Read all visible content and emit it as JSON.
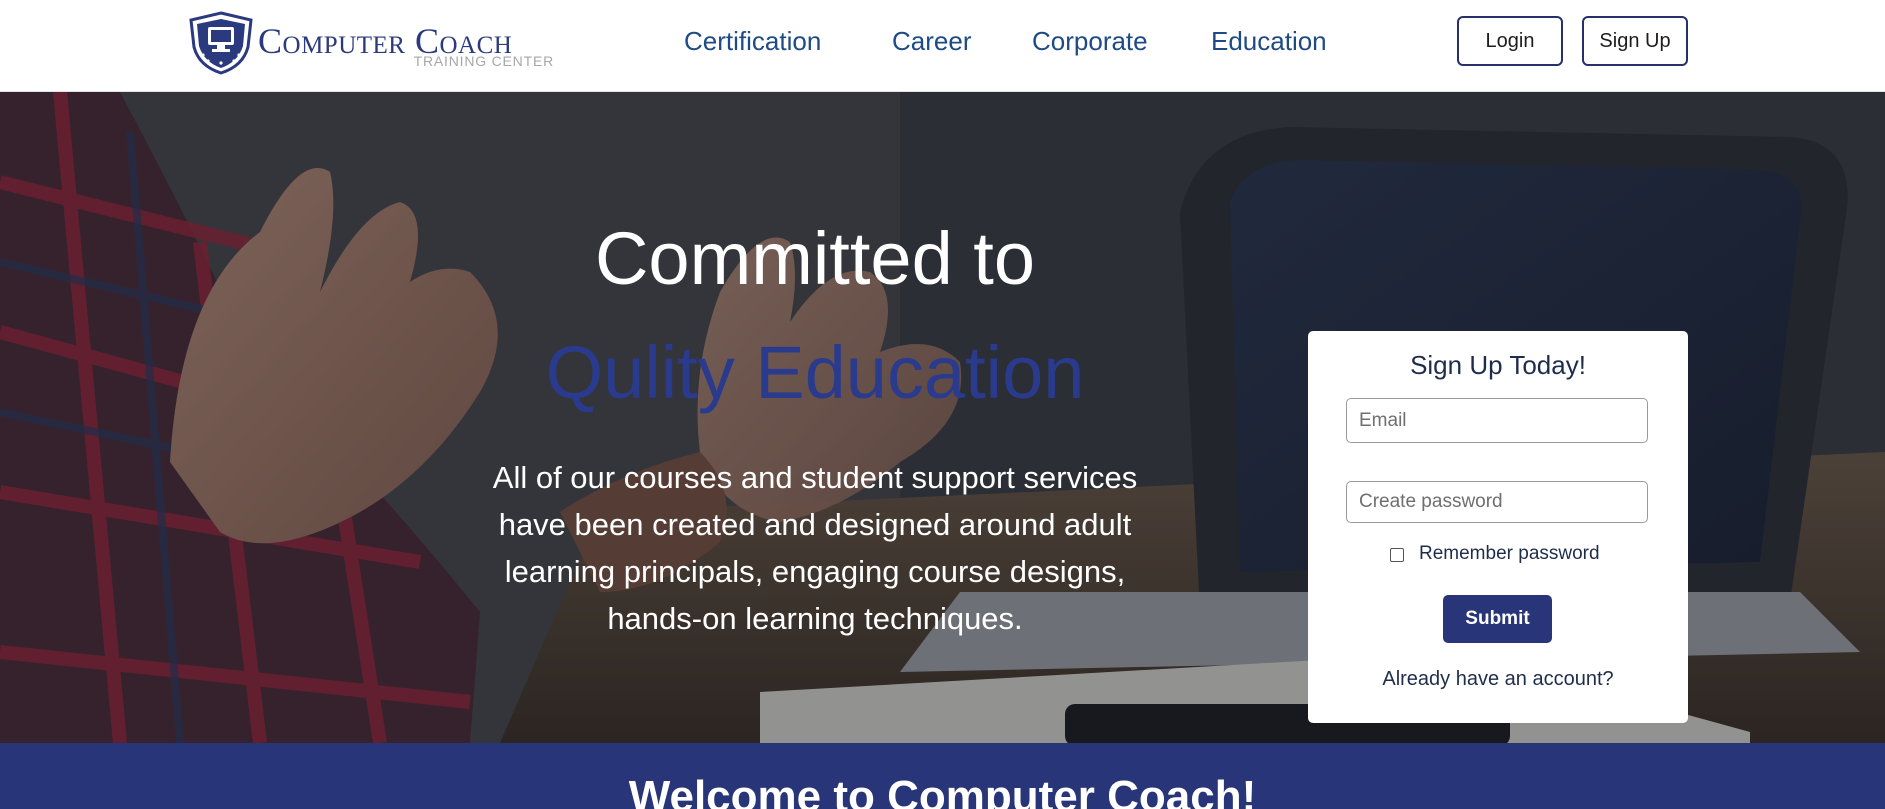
{
  "navbar": {
    "logo": {
      "title": "Computer Coach",
      "subtitle": "TRAINING CENTER"
    },
    "links": [
      "Certification",
      "Career",
      "Corporate",
      "Education"
    ],
    "login_label": "Login",
    "signup_label": "Sign Up"
  },
  "hero": {
    "headline_line1": "Committed to",
    "headline_line2": "Qulity Education",
    "description": "All of our courses and student support services have been created and designed around adult learning principals, engaging course designs, hands-on learning techniques."
  },
  "signup_card": {
    "title": "Sign Up Today!",
    "email_placeholder": "Email",
    "password_placeholder": "Create password",
    "remember_label": "Remember password",
    "submit_label": "Submit",
    "already_account": "Already have an account?"
  },
  "welcome": {
    "title": "Welcome to Computer Coach!"
  },
  "colors": {
    "brand_navy": "#283578",
    "nav_link": "#1f4b85",
    "accent_headline": "#2a3b8e"
  },
  "icons": {
    "logo": "monitor-shield-icon",
    "checkbox": "checkbox-unchecked-icon"
  }
}
